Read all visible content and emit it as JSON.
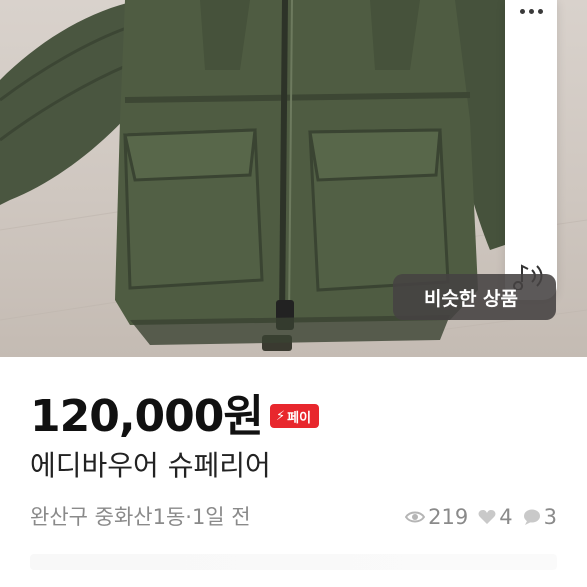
{
  "listing": {
    "price": "120,000원",
    "pay_badge": "페이",
    "title": "에디바우어 슈페리어",
    "location_time": "완산구 중화산1동·1일 전",
    "views": "219",
    "likes": "4",
    "chats": "3"
  },
  "photo_overlay": {
    "similar_label": "비슷한 상품"
  },
  "icons": {
    "more": "more-dots-icon",
    "sound": "sound-note-icon",
    "pay": "lightning-icon",
    "views": "eye-icon",
    "likes": "heart-icon",
    "chats": "chat-bubble-icon"
  },
  "colors": {
    "pay_badge": "#e8272d",
    "price": "#111111",
    "meta": "#8a8a8a",
    "jacket": "#4d5a3e"
  }
}
